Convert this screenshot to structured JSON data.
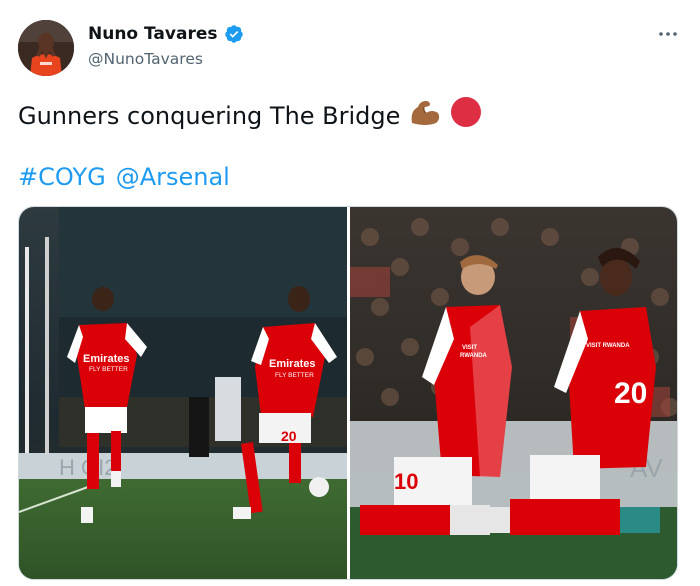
{
  "author": {
    "display_name": "Nuno Tavares",
    "handle": "@NunoTavares",
    "verified": true,
    "avatar_icon": "player-avatar"
  },
  "menu": {
    "icon": "more-horizontal-icon"
  },
  "tweet": {
    "text": "Gunners conquering The Bridge",
    "emojis": [
      "flexed-biceps-emoji",
      "red-circle-emoji"
    ],
    "hashtags": [
      "#COYG",
      "@Arsenal"
    ]
  },
  "media": {
    "photos": [
      {
        "name": "photo-players-celebrating",
        "kit_sponsor_1": "Emirates",
        "kit_tagline_1": "FLY BETTER",
        "kit_sponsor_2": "Emirates",
        "kit_tagline_2": "FLY BETTER",
        "shirt_number": "20"
      },
      {
        "name": "photo-players-kneeling",
        "shirt_sponsor": "VISIT RWANDA",
        "shirt_number": "20",
        "shirt_number_left": "10"
      }
    ]
  },
  "colors": {
    "link": "#1d9bf0",
    "verified": "#1d9bf0",
    "secondary_text": "#536471",
    "arsenal_red": "#db0007"
  }
}
